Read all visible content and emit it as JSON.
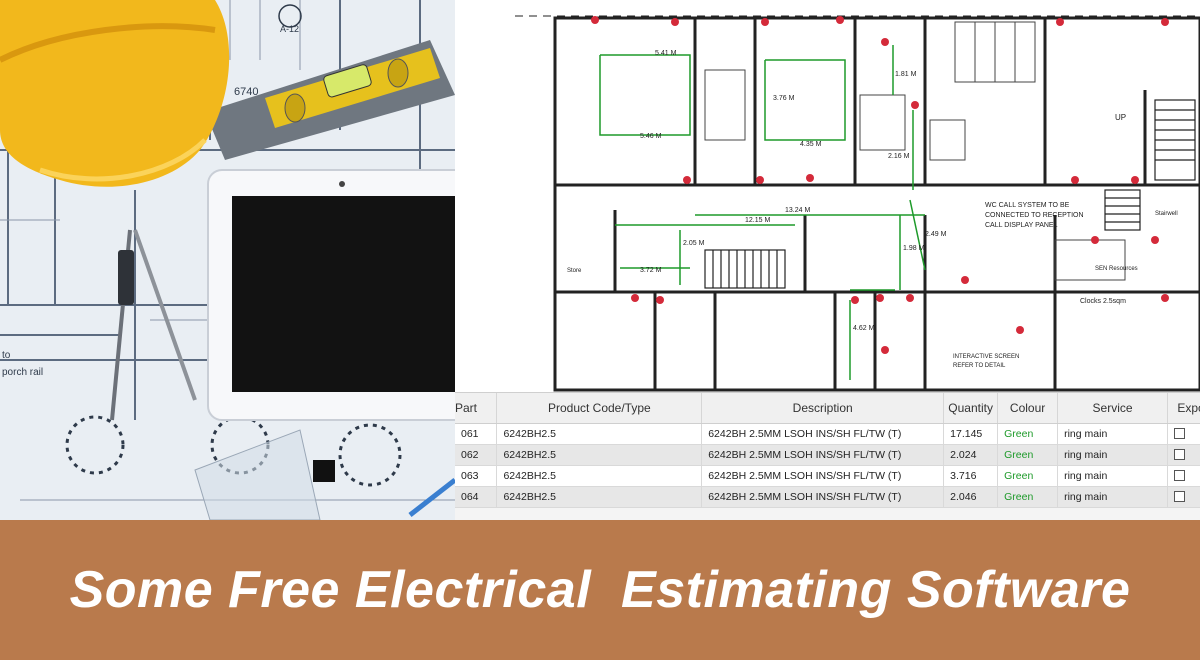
{
  "banner": {
    "title": "Some Free Electrical  Estimating Software"
  },
  "photo": {
    "level_label": "6740",
    "note_label_1": "to",
    "note_label_2": "porch rail",
    "grid_label": "A-12",
    "icons": [
      "hard-hat-icon",
      "spirit-level-icon",
      "tablet-icon",
      "compass-icon",
      "pencil-icon"
    ]
  },
  "floorplan": {
    "notice_1": "WC CALL SYSTEM TO BE",
    "notice_2": "CONNECTED TO RECEPTION",
    "notice_3": "CALL DISPLAY PANEL",
    "interactive_1": "INTERACTIVE SCREEN",
    "interactive_2": "REFER TO DETAIL",
    "room_store": "Store",
    "room_clocks": "Clocks 2.5sqm",
    "room_stairwell": "Stairwell",
    "room_sen": "SEN Resources",
    "up_label": "UP",
    "measures": [
      "5.41 M",
      "5.46 M",
      "4.35 M",
      "13.24 M",
      "12.15 M",
      "3.72 M",
      "1.81 M",
      "2.16 M",
      "1.98 M",
      "2.49 M",
      "4.62 M",
      "3.76 M",
      "2.05 M"
    ]
  },
  "table": {
    "headers": [
      "Part",
      "Product Code/Type",
      "Description",
      "Quantity",
      "Colour",
      "Service",
      "Expo"
    ],
    "rows": [
      {
        "part": "061",
        "code": "6242BH2.5",
        "desc": "6242BH 2.5MM LSOH INS/SH FL/TW (T)",
        "qty": "17.145",
        "colour": "Green",
        "service": "ring main"
      },
      {
        "part": "062",
        "code": "6242BH2.5",
        "desc": "6242BH 2.5MM LSOH INS/SH FL/TW (T)",
        "qty": "2.024",
        "colour": "Green",
        "service": "ring main"
      },
      {
        "part": "063",
        "code": "6242BH2.5",
        "desc": "6242BH 2.5MM LSOH INS/SH FL/TW (T)",
        "qty": "3.716",
        "colour": "Green",
        "service": "ring main"
      },
      {
        "part": "064",
        "code": "6242BH2.5",
        "desc": "6242BH 2.5MM LSOH INS/SH FL/TW (T)",
        "qty": "2.046",
        "colour": "Green",
        "service": "ring main"
      }
    ]
  },
  "colors": {
    "banner": "#b97a4c",
    "hat": "#f2b81c",
    "cable": "#1e9a2a",
    "socket": "#d42a3a"
  }
}
